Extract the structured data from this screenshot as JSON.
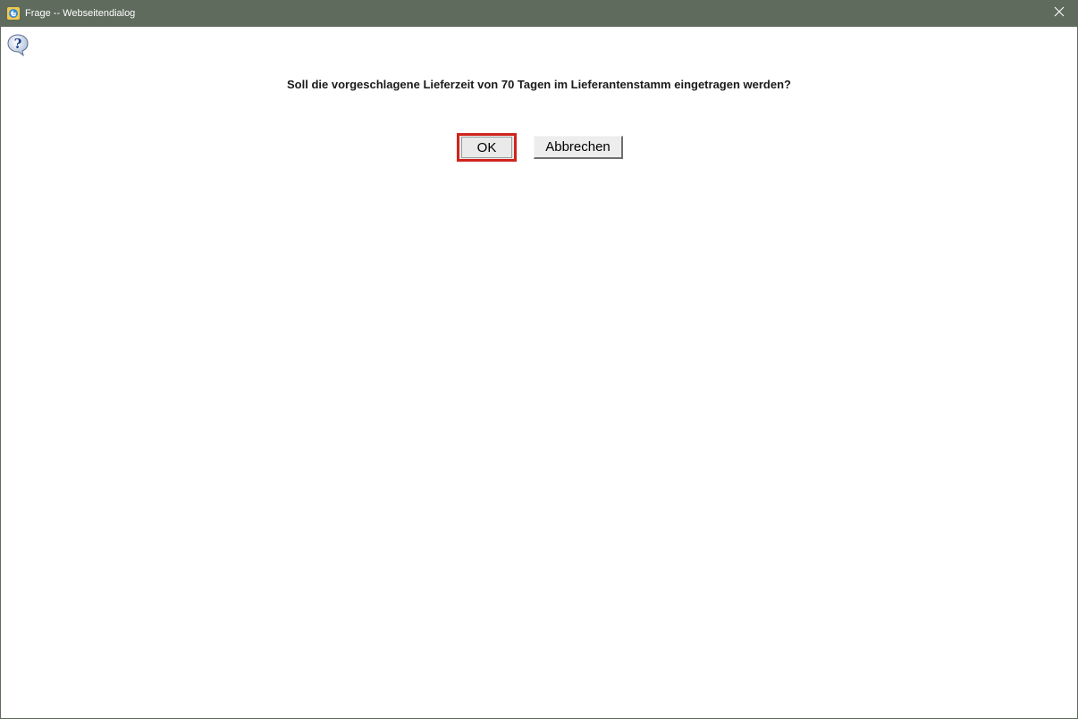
{
  "window": {
    "title": "Frage -- Webseitendialog",
    "close_symbol": "×"
  },
  "icons": {
    "app_icon": "ie-page-icon",
    "question_icon": "question-icon",
    "close_icon": "close-icon"
  },
  "dialog": {
    "message": "Soll die vorgeschlagene Lieferzeit von 70 Tagen im Lieferantenstamm eingetragen werden?",
    "ok_label": "OK",
    "cancel_label": "Abbrechen"
  },
  "colors": {
    "titlebar": "#5f6b5c",
    "highlight": "#d0241e"
  }
}
